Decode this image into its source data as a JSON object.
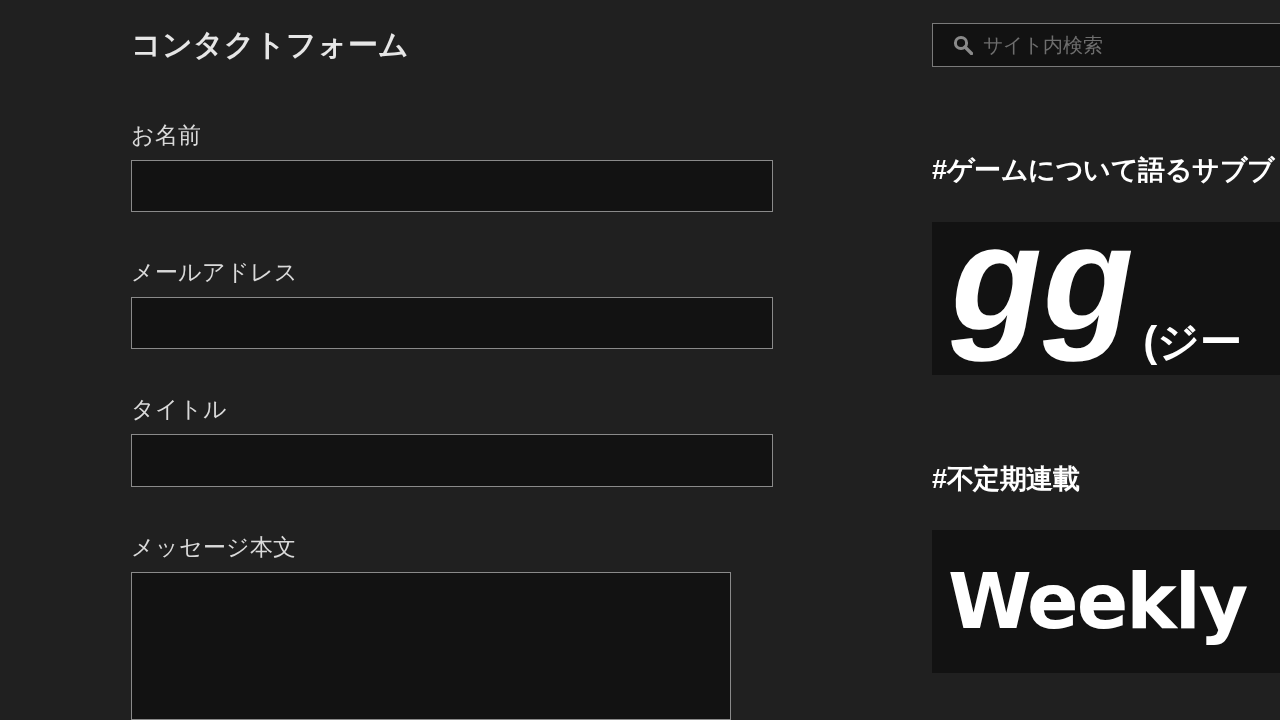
{
  "main": {
    "title": "コンタクトフォーム",
    "fields": [
      {
        "label": "お名前",
        "kind": "text"
      },
      {
        "label": "メールアドレス",
        "kind": "text"
      },
      {
        "label": "タイトル",
        "kind": "text"
      },
      {
        "label": "メッセージ本文",
        "kind": "textarea"
      }
    ]
  },
  "sidebar": {
    "search": {
      "placeholder": "サイト内検索"
    },
    "sections": [
      {
        "heading": "#ゲームについて語るサブブ",
        "banner": {
          "kind": "logo",
          "title": "gg",
          "subtitle": "(ジー"
        }
      },
      {
        "heading": "#不定期連載",
        "banner": {
          "kind": "script",
          "title": "Weekly"
        }
      }
    ]
  }
}
